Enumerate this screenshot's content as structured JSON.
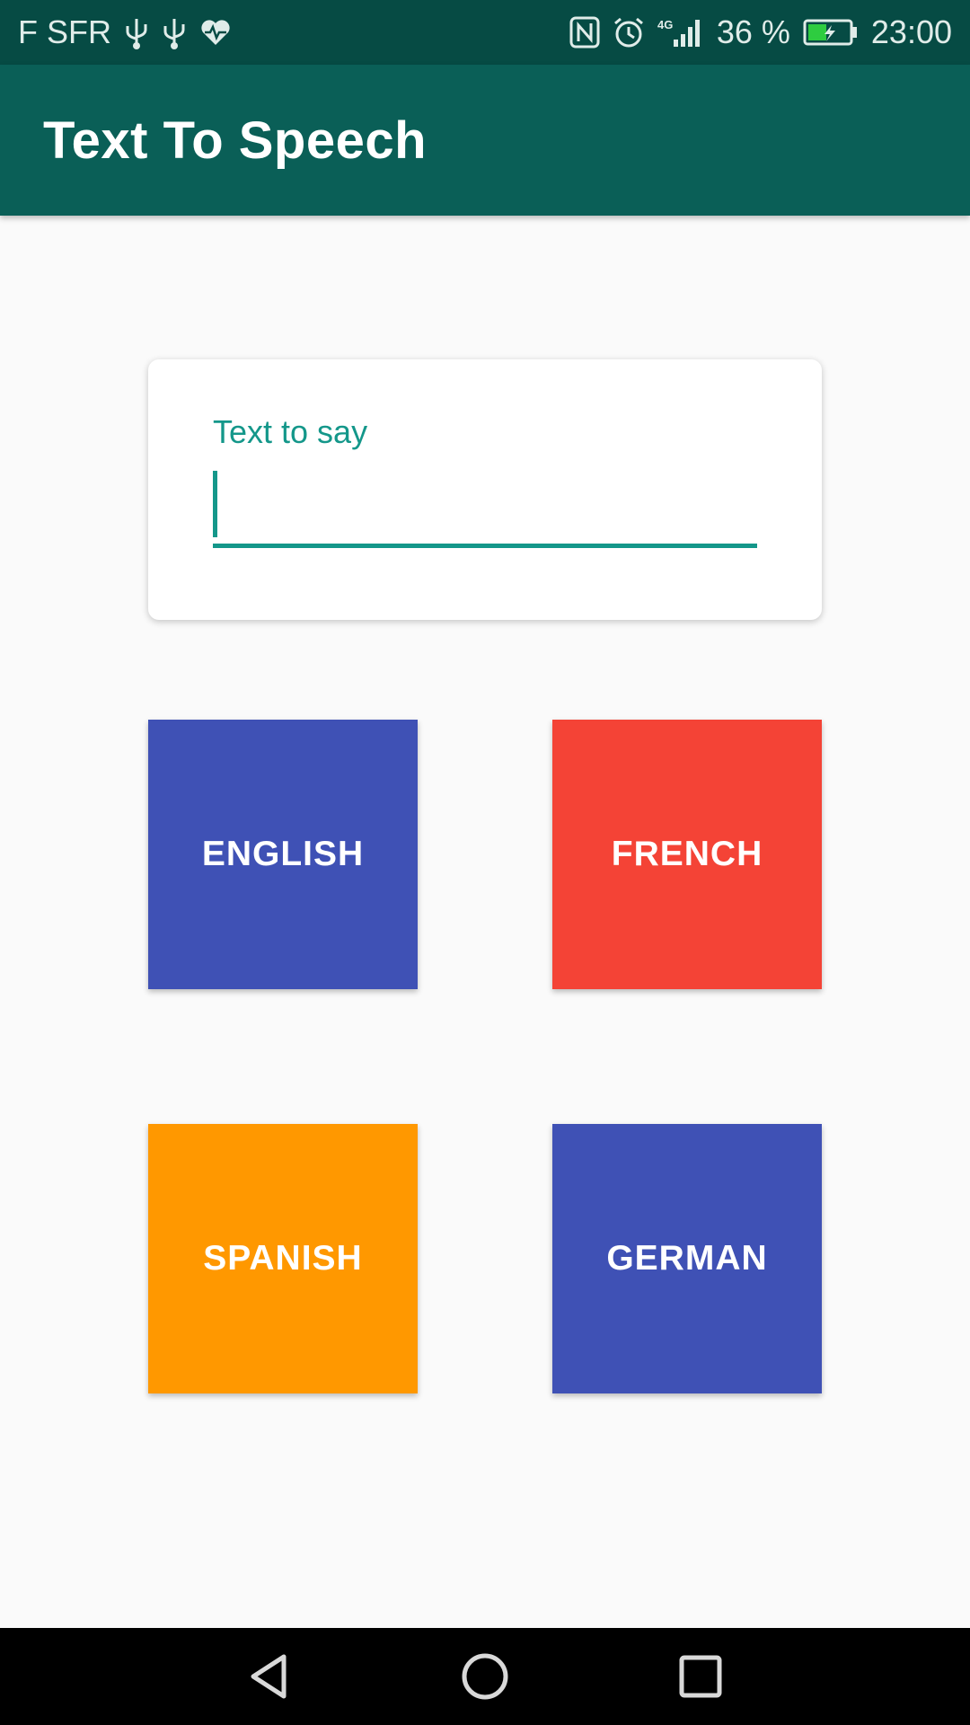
{
  "status_bar": {
    "carrier": "F SFR",
    "battery_percent": "36 %",
    "time": "23:00",
    "network": "4G",
    "icons": [
      "usb-icon",
      "usb-icon",
      "health-icon",
      "nfc-icon",
      "alarm-icon",
      "signal-icon",
      "battery-charging-icon"
    ]
  },
  "app_bar": {
    "title": "Text To Speech"
  },
  "input": {
    "label": "Text to say",
    "value": ""
  },
  "buttons": [
    {
      "label": "ENGLISH",
      "color": "#3f51b5"
    },
    {
      "label": "FRENCH",
      "color": "#f44336"
    },
    {
      "label": "SPANISH",
      "color": "#ff9800"
    },
    {
      "label": "GERMAN",
      "color": "#3f51b5"
    }
  ],
  "nav_bar": {
    "icons": [
      "back-icon",
      "home-icon",
      "recents-icon"
    ]
  }
}
